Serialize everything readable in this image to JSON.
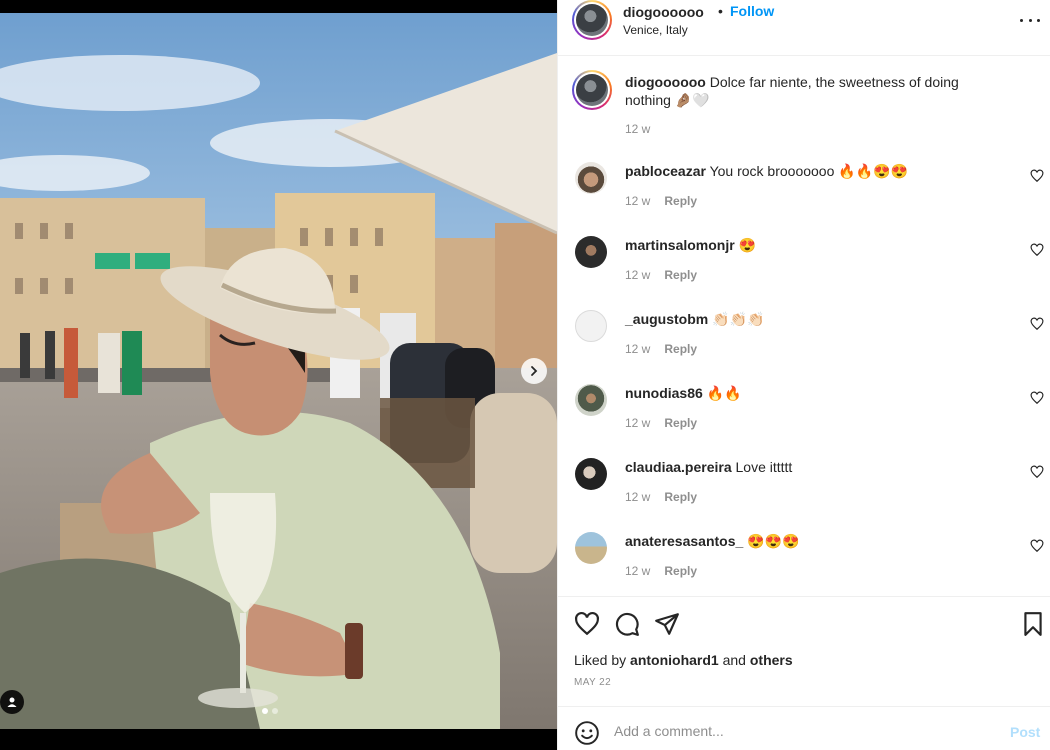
{
  "post": {
    "username": "diogoooooo",
    "separator": "•",
    "follow_label": "Follow",
    "location": "Venice, Italy",
    "caption": {
      "username": "diogoooooo",
      "text": "Dolce far niente, the sweetness of doing nothing 🤌🏽🤍",
      "time": "12 w"
    }
  },
  "comments": [
    {
      "username": "pabloceazar",
      "text": "You rock brooooooo 🔥🔥😍😍",
      "time": "12 w",
      "reply_label": "Reply"
    },
    {
      "username": "martinsalomonjr",
      "text": "😍",
      "time": "12 w",
      "reply_label": "Reply"
    },
    {
      "username": "_augustobm",
      "text": "👏🏻👏🏻👏🏻",
      "time": "12 w",
      "reply_label": "Reply"
    },
    {
      "username": "nunodias86",
      "text": "🔥🔥",
      "time": "12 w",
      "reply_label": "Reply"
    },
    {
      "username": "claudiaa.pereira",
      "text": "Love ittttt",
      "time": "12 w",
      "reply_label": "Reply"
    },
    {
      "username": "anateresasantos_",
      "text": "😍😍😍",
      "time": "12 w",
      "reply_label": "Reply"
    }
  ],
  "likes": {
    "prefix": "Liked by",
    "user": "antoniohard1",
    "joiner": "and",
    "others": "others"
  },
  "date": "MAY 22",
  "add_comment": {
    "placeholder": "Add a comment...",
    "post_label": "Post"
  },
  "carousel": {
    "current": 1,
    "total": 2
  },
  "icons": [
    "heart-icon",
    "comment-icon",
    "share-icon",
    "bookmark-icon",
    "emoji-icon",
    "more-icon",
    "chevron-right-icon",
    "user-tag-icon"
  ],
  "colors": {
    "accent": "#0095f6",
    "post_disabled": "#b2dffc",
    "muted": "#8e8e8e",
    "text": "#262626"
  }
}
